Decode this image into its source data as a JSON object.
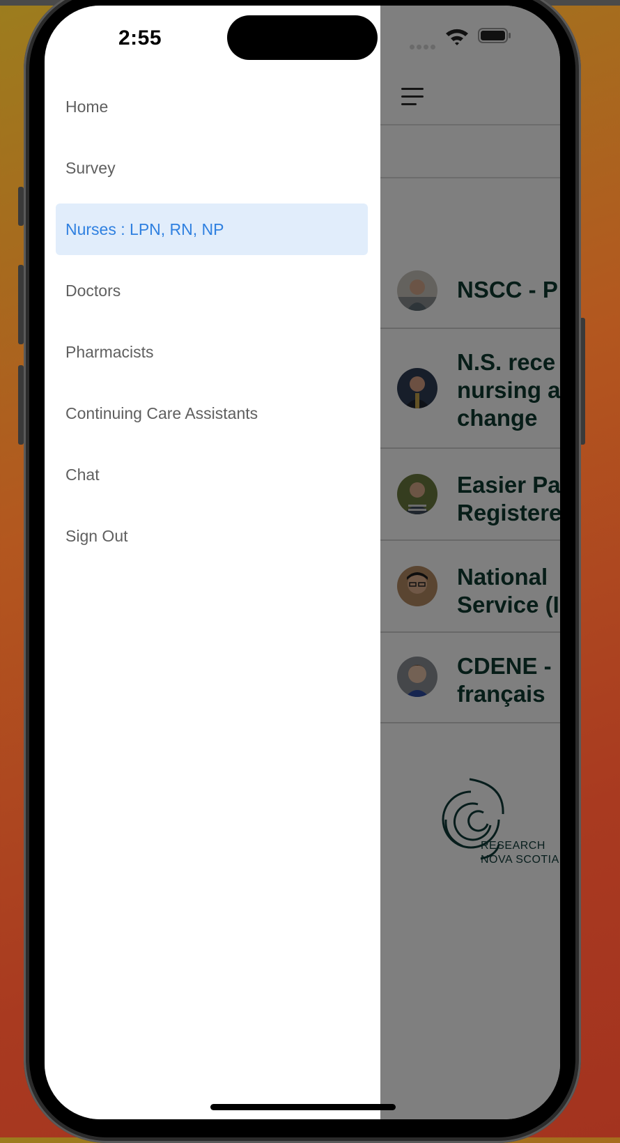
{
  "status_bar": {
    "time": "2:55"
  },
  "drawer": {
    "items": [
      {
        "label": "Home",
        "active": false
      },
      {
        "label": "Survey",
        "active": false
      },
      {
        "label": "Nurses : LPN, RN, NP",
        "active": true
      },
      {
        "label": "Doctors",
        "active": false
      },
      {
        "label": "Pharmacists",
        "active": false
      },
      {
        "label": "Continuing Care Assistants",
        "active": false
      },
      {
        "label": "Chat",
        "active": false
      },
      {
        "label": "Sign Out",
        "active": false
      }
    ]
  },
  "main": {
    "rows": [
      {
        "title": "NSCC - P"
      },
      {
        "title": "N.S. rece\nnursing a\nchange"
      },
      {
        "title": "Easier Pa\nRegistere"
      },
      {
        "title": "National\nService (I"
      },
      {
        "title": "CDENE -\nfrançais"
      }
    ],
    "logo": {
      "line1": "RESEARCH",
      "line2": "NOVA SCOTIA"
    }
  },
  "colors": {
    "active_bg": "#e1edfb",
    "active_text": "#2f80e0",
    "title_text": "#0f3b31"
  }
}
